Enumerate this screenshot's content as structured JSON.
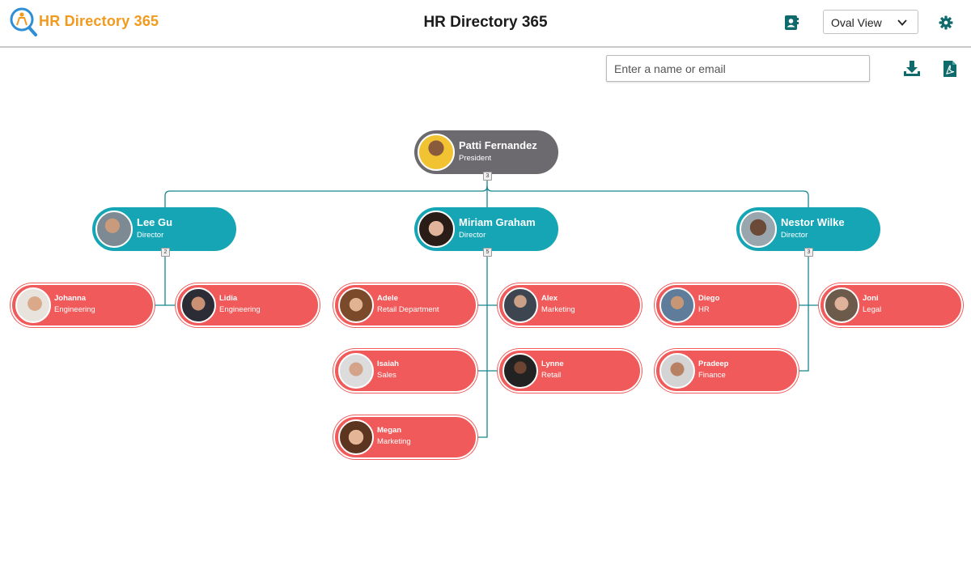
{
  "app": {
    "logo_text": "HR Directory 365",
    "title": "HR Directory 365"
  },
  "view_select": {
    "value": "Oval View"
  },
  "search": {
    "placeholder": "Enter a name or email",
    "value": ""
  },
  "icons": {
    "logo": "magnifier-org-icon",
    "contact": "contact-book-icon",
    "chevron": "chevron-down-icon",
    "settings": "gear-icon",
    "download": "download-icon",
    "pdf": "pdf-file-icon"
  },
  "colors": {
    "accent": "#f29a1d",
    "icon": "#0f6b6b",
    "president": "#6c6a6e",
    "director": "#16a5b5",
    "staff": "#f05a5a",
    "connector": "#16868f"
  },
  "org": {
    "president": {
      "name": "Patti Fernandez",
      "title": "President",
      "reports": "3"
    },
    "directors": [
      {
        "name": "Lee Gu",
        "title": "Director",
        "reports": "2"
      },
      {
        "name": "Miriam Graham",
        "title": "Director",
        "reports": "5"
      },
      {
        "name": "Nestor Wilke",
        "title": "Director",
        "reports": "3"
      }
    ],
    "staff": [
      {
        "name": "Johanna",
        "title": "Engineering"
      },
      {
        "name": "Lidia",
        "title": "Engineering"
      },
      {
        "name": "Adele",
        "title": "Retail Department"
      },
      {
        "name": "Alex",
        "title": "Marketing"
      },
      {
        "name": "Isaiah",
        "title": "Sales"
      },
      {
        "name": "Lynne",
        "title": "Retail"
      },
      {
        "name": "Megan",
        "title": "Marketing"
      },
      {
        "name": "Diego",
        "title": "HR"
      },
      {
        "name": "Joni",
        "title": "Legal"
      },
      {
        "name": "Pradeep",
        "title": "Finance"
      }
    ]
  }
}
